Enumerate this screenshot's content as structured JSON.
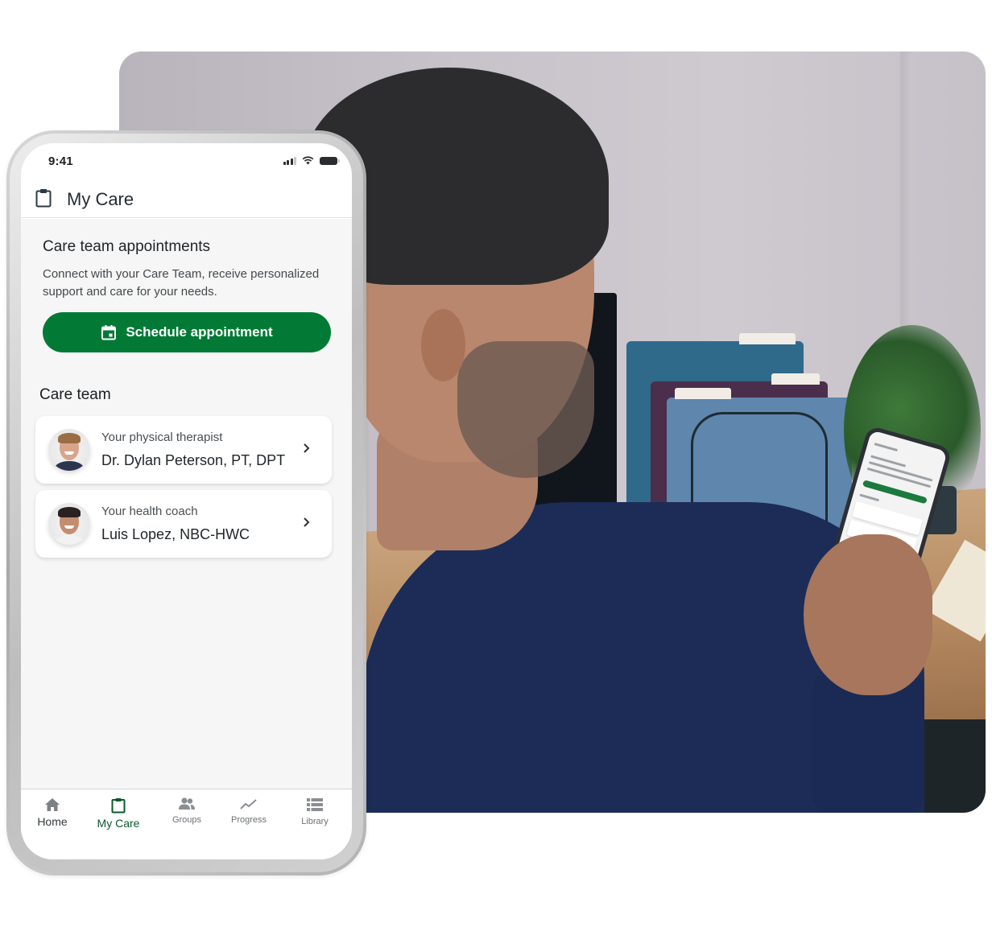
{
  "status_bar": {
    "time": "9:41",
    "icons": [
      "cellular-signal-icon",
      "wifi-icon",
      "battery-icon"
    ]
  },
  "header": {
    "icon": "clipboard-icon",
    "title": "My Care"
  },
  "appointments": {
    "title": "Care team appointments",
    "description": "Connect with your Care Team, receive personalized support and care for your needs.",
    "button_icon": "calendar-icon",
    "button_label": "Schedule appointment"
  },
  "care_team": {
    "title": "Care team",
    "members": [
      {
        "role": "Your physical therapist",
        "name": "Dr. Dylan Peterson, PT, DPT",
        "avatar": "therapist-avatar"
      },
      {
        "role": "Your health coach",
        "name": "Luis Lopez, NBC-HWC",
        "avatar": "coach-avatar"
      }
    ]
  },
  "tab_bar": {
    "tabs": [
      {
        "label": "Home",
        "icon": "home-icon",
        "active": false
      },
      {
        "label": "My Care",
        "icon": "clipboard-icon",
        "active": true
      },
      {
        "label": "Groups",
        "icon": "groups-icon",
        "active": false
      },
      {
        "label": "Progress",
        "icon": "trending-line-icon",
        "active": false
      },
      {
        "label": "Library",
        "icon": "list-icon",
        "active": false
      }
    ]
  },
  "colors": {
    "primary_green": "#027a36",
    "active_tab": "#0b5a2a",
    "text_dark": "#1f2428",
    "background": "#f6f6f6"
  },
  "photo": {
    "description": "Man at a desk holding a phone showing the My Care screen"
  }
}
